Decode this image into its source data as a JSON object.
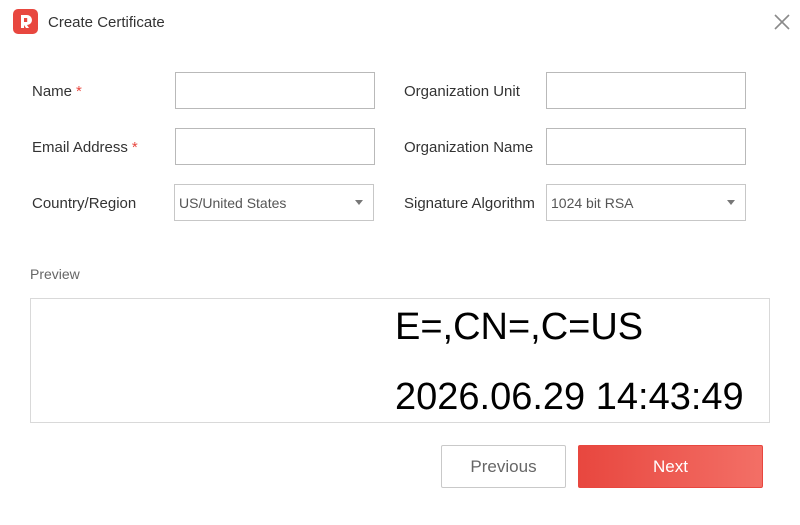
{
  "window": {
    "title": "Create Certificate",
    "logo_icon": "app-logo-icon",
    "close_icon": "close-icon",
    "accent_color": "#e8473f"
  },
  "form": {
    "name_label": "Name",
    "email_label": "Email Address",
    "required_mark": "*",
    "country_label": "Country/Region",
    "country_value": "US/United States",
    "org_unit_label": "Organization Unit",
    "org_name_label": "Organization Name",
    "sig_label": "Signature Algorithm",
    "sig_value": "1024 bit RSA",
    "name_value": "",
    "email_value": "",
    "org_unit_value": "",
    "org_name_value": ""
  },
  "preview": {
    "label": "Preview",
    "line1": "E=,CN=,C=US",
    "line2": "2026.06.29 14:43:49"
  },
  "buttons": {
    "previous": "Previous",
    "next": "Next"
  }
}
